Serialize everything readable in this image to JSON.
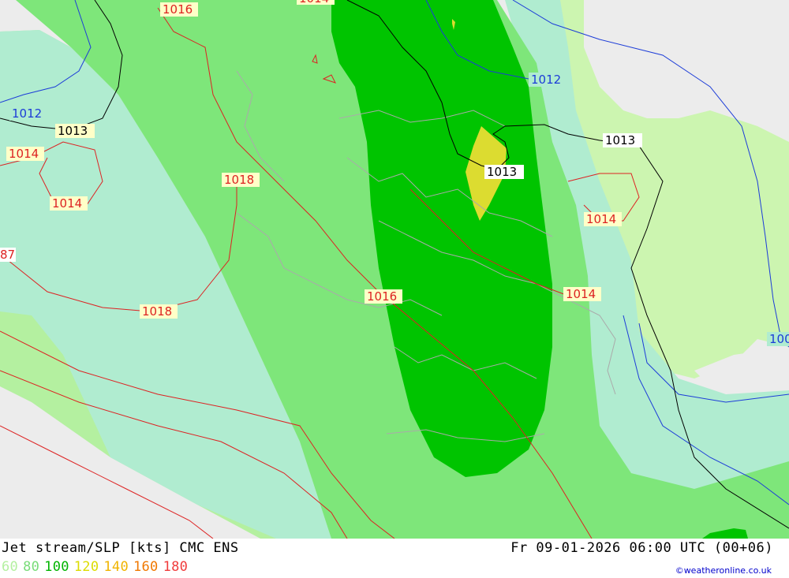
{
  "header": {
    "title": "Jet stream/SLP [kts] CMC ENS",
    "valid_time": "Fr 09-01-2026 06:00 UTC (00+06)"
  },
  "legend": {
    "items": [
      {
        "label": "60",
        "color": "#b4f0a0"
      },
      {
        "label": "80",
        "color": "#78dc78"
      },
      {
        "label": "100",
        "color": "#00b400"
      },
      {
        "label": "120",
        "color": "#dcdc00"
      },
      {
        "label": "140",
        "color": "#f0b400"
      },
      {
        "label": "160",
        "color": "#f07800"
      },
      {
        "label": "180",
        "color": "#f03c3c"
      }
    ]
  },
  "credit": "©weatheronline.co.uk",
  "isobar_labels": [
    {
      "text": "1016",
      "color": "#dd2222"
    },
    {
      "text": "1012",
      "color": "#1c3cd8"
    },
    {
      "text": "1013",
      "color": "#000000"
    },
    {
      "text": "1014",
      "color": "#dd2222"
    },
    {
      "text": "1014",
      "color": "#dd2222"
    },
    {
      "text": "1018",
      "color": "#dd2222"
    },
    {
      "text": "1018",
      "color": "#dd2222"
    },
    {
      "text": "1016",
      "color": "#dd2222"
    },
    {
      "text": "1012",
      "color": "#1c3cd8"
    },
    {
      "text": "1013",
      "color": "#000000"
    },
    {
      "text": "1013",
      "color": "#000000"
    },
    {
      "text": "1014",
      "color": "#dd2222"
    },
    {
      "text": "1014",
      "color": "#dd2222"
    },
    {
      "text": "1014",
      "color": "#dd2222"
    },
    {
      "text": "100",
      "color": "#1c3cd8"
    },
    {
      "text": "87",
      "color": "#dd2222"
    }
  ]
}
